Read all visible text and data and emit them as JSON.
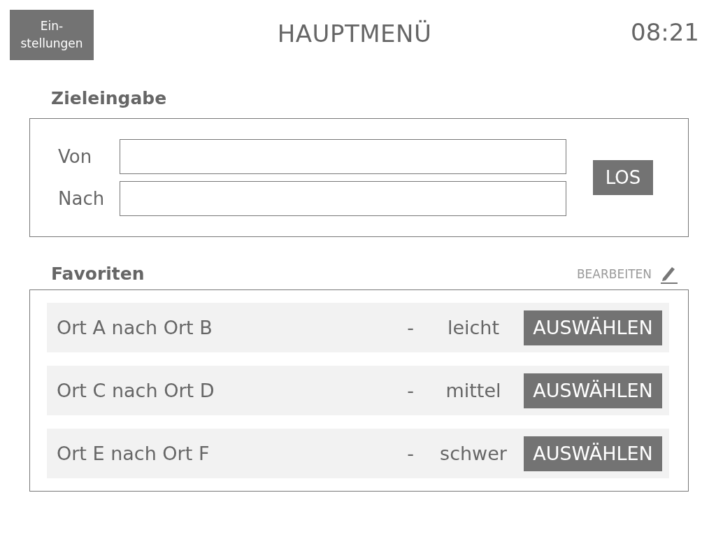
{
  "header": {
    "settings_button": [
      "Ein-",
      "stellungen"
    ],
    "title": "HAUPTMENÜ",
    "time": "08:21"
  },
  "destination": {
    "heading": "Zieleingabe",
    "fields": [
      {
        "label": "Von"
      },
      {
        "label": "Nach"
      }
    ],
    "go_button": "LOS"
  },
  "favorites": {
    "heading": "Favoriten",
    "edit_link": "BEARBEITEN",
    "rows": [
      {
        "route": "Ort A nach Ort B",
        "separator": "-",
        "difficulty": "leicht",
        "button": "AUSWÄHLEN"
      },
      {
        "route": "Ort C nach Ort D",
        "separator": "-",
        "difficulty": "mittel",
        "button": "AUSWÄHLEN"
      },
      {
        "route": "Ort E nach Ort F",
        "separator": "-",
        "difficulty": "schwer",
        "button": "AUSWÄHLEN"
      }
    ]
  }
}
